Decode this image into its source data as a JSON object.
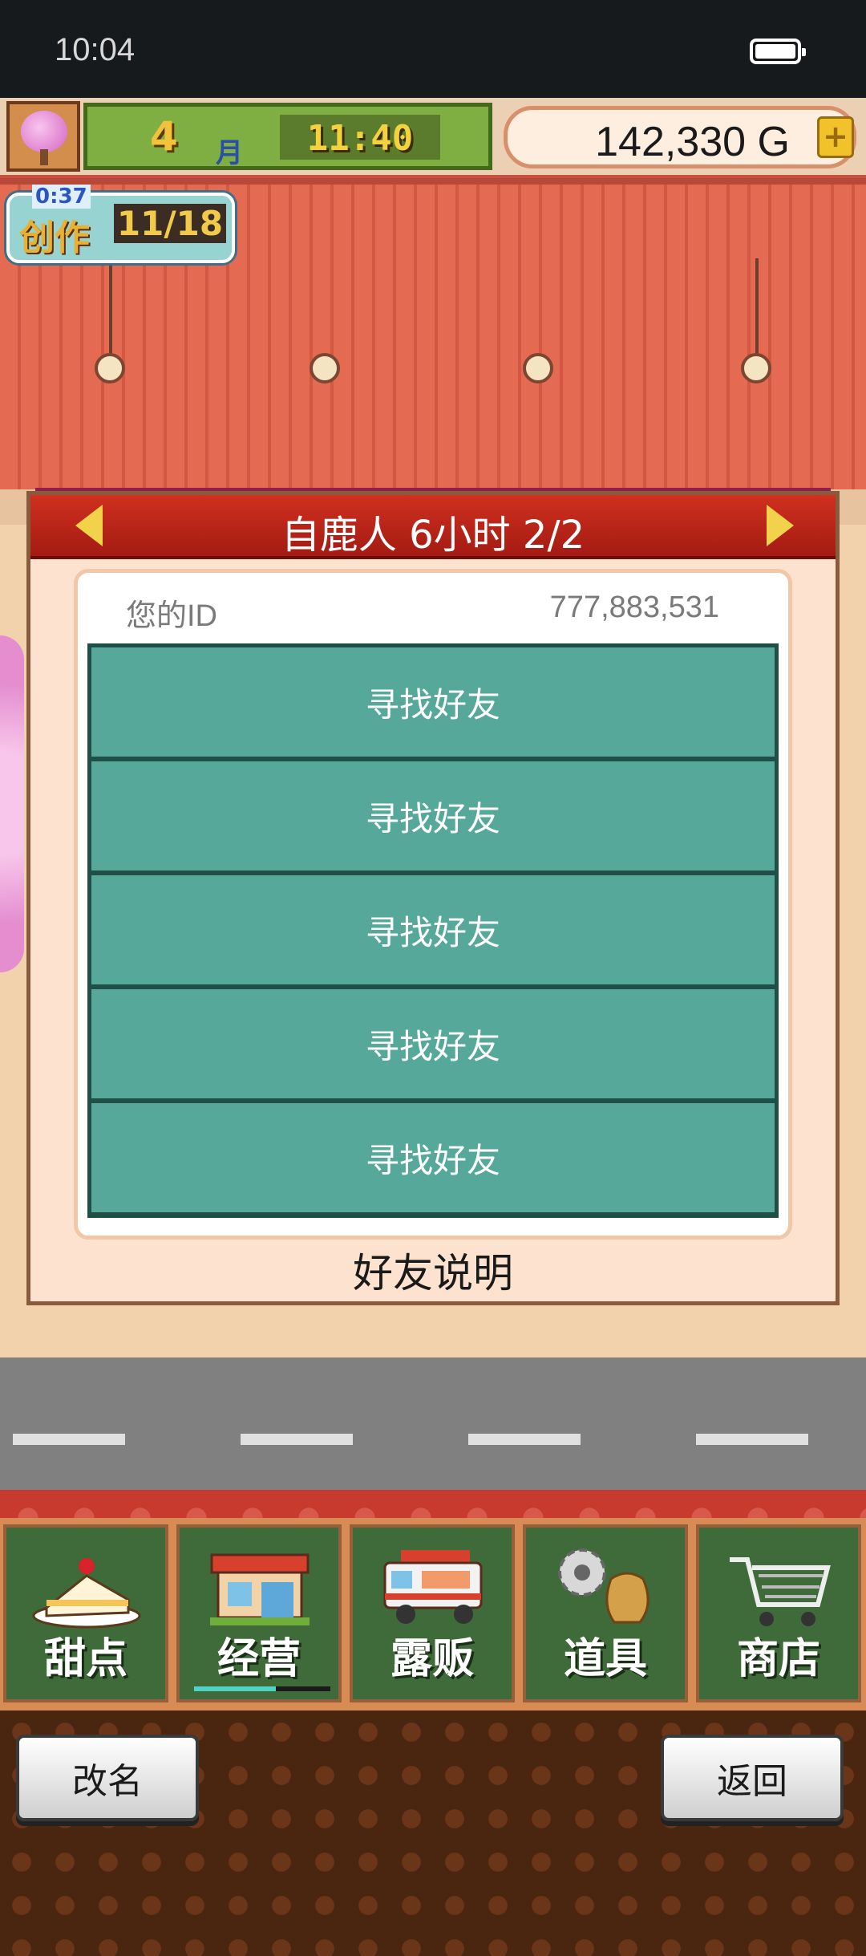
{
  "status_bar": {
    "time": "10:04"
  },
  "hud": {
    "month_number": "4",
    "month_unit": "月",
    "time": "11:40",
    "money": "142,330 G",
    "add_money_symbol": "+"
  },
  "creation": {
    "timer": "0:37",
    "label": "创作",
    "count": "11/18"
  },
  "dialog": {
    "title": "自鹿人  6小时 2/2",
    "id_label": "您的ID",
    "id_value": "777,883,531",
    "friend_slots": [
      "寻找好友",
      "寻找好友",
      "寻找好友",
      "寻找好友",
      "寻找好友"
    ],
    "help_label": "好友说明"
  },
  "menu": {
    "tabs": [
      {
        "label": "甜点",
        "icon": "cake-icon"
      },
      {
        "label": "经营",
        "icon": "shop-icon",
        "active": true
      },
      {
        "label": "露贩",
        "icon": "food-truck-icon"
      },
      {
        "label": "道具",
        "icon": "gear-bag-icon"
      },
      {
        "label": "商店",
        "icon": "cart-icon"
      }
    ]
  },
  "bottom": {
    "rename_label": "改名",
    "back_label": "返回"
  },
  "colors": {
    "dialog_header": "#b82214",
    "friend_slot": "#56a89a",
    "menu_tab": "#3f6a39"
  }
}
